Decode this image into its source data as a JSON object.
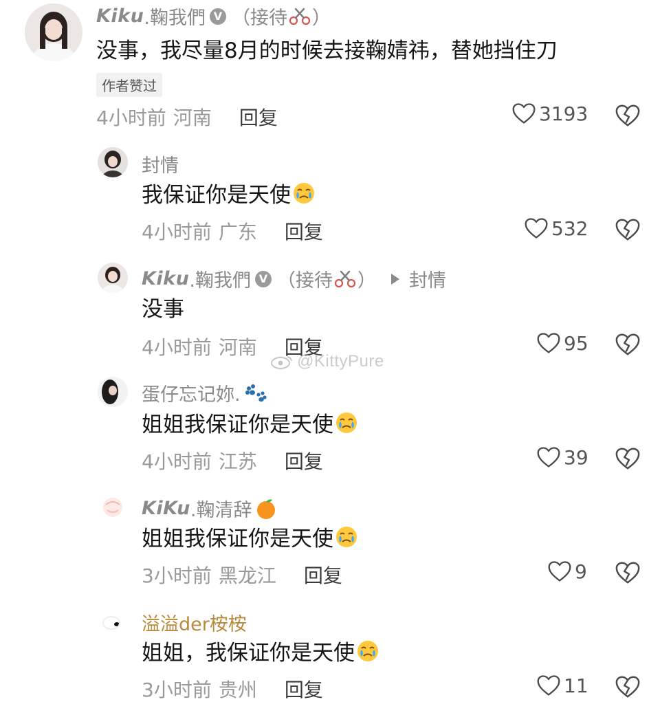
{
  "comments": [
    {
      "user_latin": "Kiku",
      "user_cn": ".鞠我們",
      "user_tag_open": "（接待",
      "user_tag_close": "）",
      "text": "没事，我尽量8月的时候去接鞠婧祎，替她挡住刀",
      "author_liked": "作者赞过",
      "time": "4小时前",
      "location": "河南",
      "reply_label": "回复",
      "likes": "3193"
    },
    {
      "user": "封情",
      "text": "我保证你是天使",
      "time": "4小时前",
      "location": "广东",
      "reply_label": "回复",
      "likes": "532"
    },
    {
      "user_latin": "Kiku",
      "user_cn": ".鞠我們",
      "user_tag_open": "（接待",
      "user_tag_close": "）",
      "reply_to": "封情",
      "text": "没事",
      "time": "4小时前",
      "location": "河南",
      "reply_label": "回复",
      "likes": "95"
    },
    {
      "user": "蛋仔忘记妳.",
      "text": "姐姐我保证你是天使",
      "time": "4小时前",
      "location": "江苏",
      "reply_label": "回复",
      "likes": "39"
    },
    {
      "user_latin": "KiKu",
      "user_cn": ".鞠清辞",
      "text": "姐姐我保证你是天使",
      "time": "3小时前",
      "location": "黑龙江",
      "reply_label": "回复",
      "likes": "9"
    },
    {
      "user": "溢溢der桉桉",
      "text": "姐姐，我保证你是天使",
      "time": "3小时前",
      "location": "贵州",
      "reply_label": "回复",
      "likes": "11"
    }
  ],
  "watermark": "@KittyPure",
  "icons": {
    "heart": "heart-outline-icon",
    "dislike": "broken-heart-icon",
    "verified": "verified-v-icon",
    "scissors": "scissors-icon",
    "cry": "crying-face-emoji",
    "paws": "paw-prints-emoji",
    "orange": "tangerine-emoji"
  },
  "colors": {
    "username": "#8a8a8a",
    "username_gold": "#b8893a",
    "text": "#161616",
    "meta": "#9a9a9a"
  }
}
